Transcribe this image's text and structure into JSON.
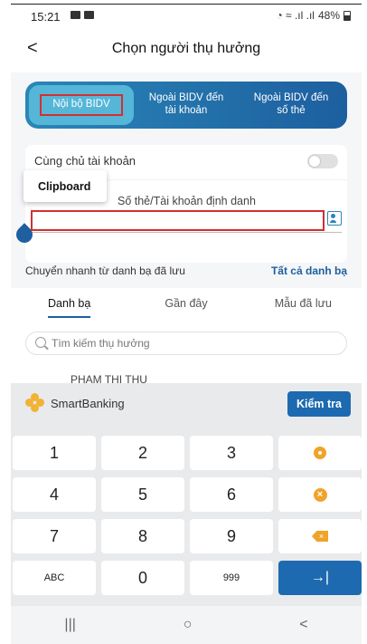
{
  "status_bar": {
    "time": "15:21",
    "battery": "48%"
  },
  "header": {
    "back_glyph": "<",
    "title": "Chọn người thụ hưởng"
  },
  "tabs": [
    {
      "label": "Nội bộ BIDV",
      "active": true
    },
    {
      "label": "Ngoài BIDV đến tài khoản",
      "active": false
    },
    {
      "label": "Ngoài BIDV đến số thẻ",
      "active": false
    }
  ],
  "form": {
    "same_owner_label": "Cùng chủ tài khoản",
    "same_owner_on": false,
    "account_label": "Số thẻ/Tài khoản định danh",
    "account_value": ""
  },
  "clipboard_popup": {
    "label": "Clipboard"
  },
  "quick_transfer": {
    "label": "Chuyển nhanh từ danh bạ đã lưu",
    "all_link": "Tất cả danh bạ"
  },
  "subtabs": [
    {
      "label": "Danh bạ",
      "active": true
    },
    {
      "label": "Gần đây",
      "active": false
    },
    {
      "label": "Mẫu đã lưu",
      "active": false
    }
  ],
  "search": {
    "placeholder": "Tìm kiếm thụ hưởng"
  },
  "peek_contact": "PHAM THI THU",
  "keyboard": {
    "brand": "SmartBanking",
    "check_label": "Kiểm tra",
    "keys": [
      "1",
      "2",
      "3",
      "settings",
      "4",
      "5",
      "6",
      "clear",
      "7",
      "8",
      "9",
      "backspace",
      "ABC",
      "0",
      "999",
      "enter"
    ],
    "enter_glyph": "→|",
    "accent_color": "#f0a32a",
    "enter_color": "#1d6ab0"
  },
  "nav_bar": {
    "recents": "|||",
    "home": "○",
    "back": "<"
  }
}
